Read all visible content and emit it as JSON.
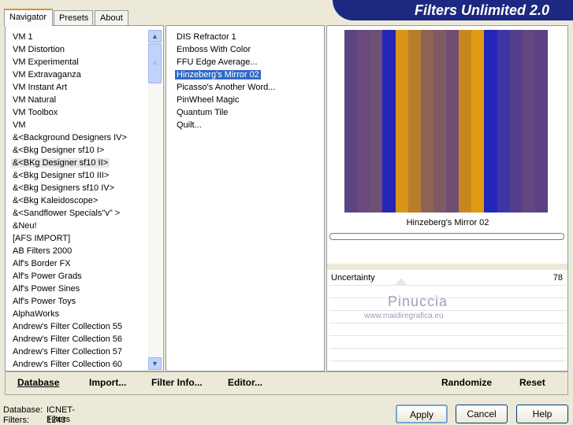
{
  "tabs": [
    {
      "label": "Navigator",
      "active": true
    },
    {
      "label": "Presets",
      "active": false
    },
    {
      "label": "About",
      "active": false
    }
  ],
  "banner": "Filters Unlimited 2.0",
  "categories": [
    "VM 1",
    "VM Distortion",
    "VM Experimental",
    "VM Extravaganza",
    "VM Instant Art",
    "VM Natural",
    "VM Toolbox",
    "VM",
    "&<Background Designers IV>",
    "&<Bkg Designer sf10 I>",
    "&<BKg Designer sf10 II>",
    "&<Bkg Designer sf10 III>",
    "&<Bkg Designers sf10 IV>",
    "&<Bkg Kaleidoscope>",
    "&<Sandflower Specials\"v\" >",
    "&Neu!",
    "[AFS IMPORT]",
    "AB Filters 2000",
    "Alf's Border FX",
    "Alf's Power Grads",
    "Alf's Power Sines",
    "Alf's Power Toys",
    "AlphaWorks",
    "Andrew's Filter Collection 55",
    "Andrew's Filter Collection 56",
    "Andrew's Filter Collection 57",
    "Andrew's Filter Collection 60"
  ],
  "selected_category": "&<BKg Designer sf10 II>",
  "filters": [
    "DIS Refractor 1",
    "Emboss With Color",
    "FFU Edge Average...",
    "Hinzeberg's Mirror 02",
    "Picasso's Another Word...",
    "PinWheel Magic",
    "Quantum Tile",
    "Quilt..."
  ],
  "selected_filter": "Hinzeberg's Mirror 02",
  "preview_stripe_colors": [
    "#5c4480",
    "#6a4a7e",
    "#6d4f78",
    "#2427b5",
    "#d89416",
    "#b77d2a",
    "#8e6354",
    "#7e5a63",
    "#6f4e72",
    "#c7871f",
    "#e29a12",
    "#2226b8",
    "#3e36a6",
    "#553f8c",
    "#63477f",
    "#5a4284"
  ],
  "filter_name_label": "Hinzeberg's Mirror 02",
  "param": {
    "label": "Uncertainty",
    "value": "78"
  },
  "watermark": {
    "name": "Pinuccia",
    "site": "www.maidiregrafica.eu"
  },
  "bottom_links": {
    "database": "Database",
    "import": "Import...",
    "filter_info": "Filter Info...",
    "editor": "Editor...",
    "randomize": "Randomize",
    "reset": "Reset"
  },
  "status": {
    "database_label": "Database:",
    "database_value": "ICNET-Filters",
    "filters_label": "Filters:",
    "filters_value": "1243"
  },
  "buttons": {
    "apply": "Apply",
    "cancel": "Cancel",
    "help": "Help"
  }
}
